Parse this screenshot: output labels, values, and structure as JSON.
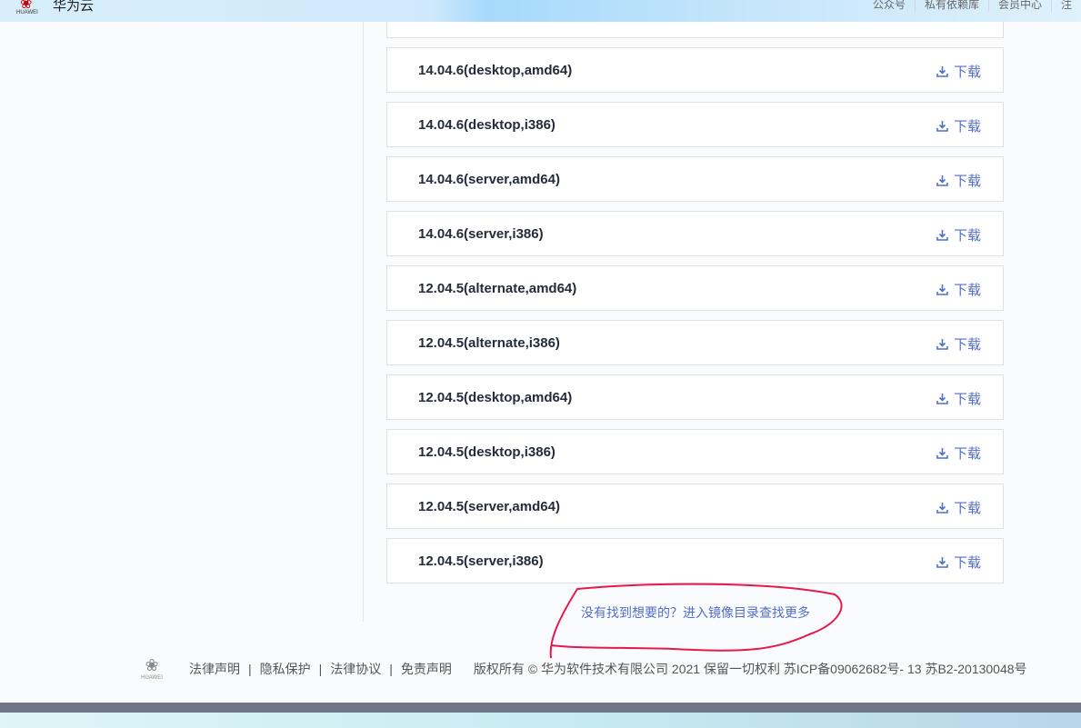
{
  "header": {
    "logo_text": "HUAWEI",
    "brand": "华为云",
    "nav": [
      "公众号",
      "私有依赖库",
      "会员中心",
      "注"
    ]
  },
  "rows": [
    {
      "name": "14.04.6(desktop,amd64)"
    },
    {
      "name": "14.04.6(desktop,i386)"
    },
    {
      "name": "14.04.6(server,amd64)"
    },
    {
      "name": "14.04.6(server,i386)"
    },
    {
      "name": "12.04.5(alternate,amd64)"
    },
    {
      "name": "12.04.5(alternate,i386)"
    },
    {
      "name": "12.04.5(desktop,amd64)"
    },
    {
      "name": "12.04.5(desktop,i386)"
    },
    {
      "name": "12.04.5(server,amd64)"
    },
    {
      "name": "12.04.5(server,i386)"
    }
  ],
  "download_label": "下载",
  "more_link": "没有找到想要的？进入镜像目录查找更多",
  "footer": {
    "logo_text": "HUAWEI",
    "links": [
      "法律声明",
      "隐私保护",
      "法律协议",
      "免责声明"
    ],
    "separator": "|",
    "copyright": "版权所有 © 华为软件技术有限公司 2021 保留一切权利 苏ICP备09062682号- 13  苏B2-20130048号"
  }
}
